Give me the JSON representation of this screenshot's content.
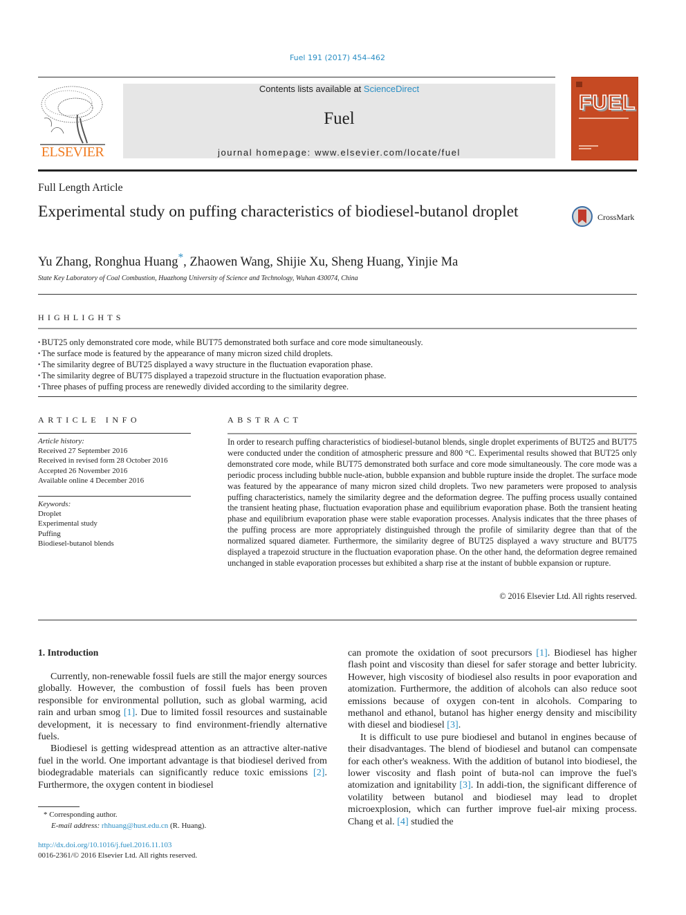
{
  "header": {
    "journal_ref": "Fuel 191 (2017) 454–462",
    "contents_prefix": "Contents lists available at ",
    "contents_link": "ScienceDirect",
    "journal_title": "Fuel",
    "homepage_prefix": "journal homepage: ",
    "homepage_url": "www.elsevier.com/locate/fuel",
    "publisher_logo": "ELSEVIER",
    "cover_title": "FUEL"
  },
  "article": {
    "type": "Full Length Article",
    "title": "Experimental study on puffing characteristics of biodiesel-butanol droplet",
    "crossmark_label": "CrossMark",
    "authors": "Yu Zhang, Ronghua Huang",
    "authors_star": "*",
    "authors_rest": ", Zhaowen Wang, Shijie Xu, Sheng Huang, Yinjie Ma",
    "affiliation": "State Key Laboratory of Coal Combustion, Huazhong University of Science and Technology, Wuhan 430074, China"
  },
  "highlights": {
    "heading": "HIGHLIGHTS",
    "items": [
      "BUT25 only demonstrated core mode, while BUT75 demonstrated both surface and core mode simultaneously.",
      "The surface mode is featured by the appearance of many micron sized child droplets.",
      "The similarity degree of BUT25 displayed a wavy structure in the fluctuation evaporation phase.",
      "The similarity degree of BUT75 displayed a trapezoid structure in the fluctuation evaporation phase.",
      "Three phases of puffing process are renewedly divided according to the similarity degree."
    ]
  },
  "article_info": {
    "heading": "ARTICLE INFO",
    "history_label": "Article history:",
    "history": [
      "Received 27 September 2016",
      "Received in revised form 28 October 2016",
      "Accepted 26 November 2016",
      "Available online 4 December 2016"
    ],
    "keywords_label": "Keywords:",
    "keywords": [
      "Droplet",
      "Experimental study",
      "Puffing",
      "Biodiesel-butanol blends"
    ]
  },
  "abstract": {
    "heading": "ABSTRACT",
    "text": "In order to research puffing characteristics of biodiesel-butanol blends, single droplet experiments of BUT25 and BUT75 were conducted under the condition of atmospheric pressure and 800 °C. Experimental results showed that BUT25 only demonstrated core mode, while BUT75 demonstrated both surface and core mode simultaneously. The core mode was a periodic process including bubble nucle-ation, bubble expansion and bubble rupture inside the droplet. The surface mode was featured by the appearance of many micron sized child droplets. Two new parameters were proposed to analysis puffing characteristics, namely the similarity degree and the deformation degree. The puffing process usually contained the transient heating phase, fluctuation evaporation phase and equilibrium evaporation phase. Both the transient heating phase and equilibrium evaporation phase were stable evaporation processes. Analysis indicates that the three phases of the puffing process are more appropriately distinguished through the profile of similarity degree than that of the normalized squared diameter. Furthermore, the similarity degree of BUT25 displayed a wavy structure and BUT75 displayed a trapezoid structure in the fluctuation evaporation phase. On the other hand, the deformation degree remained unchanged in stable evaporation processes but exhibited a sharp rise at the instant of bubble expansion or rupture.",
    "copyright": "© 2016 Elsevier Ltd. All rights reserved."
  },
  "intro": {
    "heading": "1. Introduction",
    "p1_a": "Currently, non-renewable fossil fuels are still the major energy sources globally. However, the combustion of fossil fuels has been proven responsible for environmental pollution, such as global warming, acid rain and urban smog ",
    "p1_ref": "[1]",
    "p1_b": ". Due to limited fossil resources and sustainable development, it is necessary to find environment-friendly alternative fuels.",
    "p2_a": "Biodiesel is getting widespread attention as an attractive alter-native fuel in the world. One important advantage is that biodiesel derived from biodegradable materials can significantly reduce toxic emissions ",
    "p2_ref": "[2]",
    "p2_b": ". Furthermore, the oxygen content in biodiesel",
    "r1_a": "can promote the oxidation of soot precursors ",
    "r1_ref1": "[1]",
    "r1_b": ". Biodiesel has higher flash point and viscosity than diesel for safer storage and better lubricity. However, high viscosity of biodiesel also results in poor evaporation and atomization. Furthermore, the addition of alcohols can also reduce soot emissions because of oxygen con-tent in alcohols. Comparing to methanol and ethanol, butanol has higher energy density and miscibility with diesel and biodiesel ",
    "r1_ref2": "[3]",
    "r1_c": ".",
    "r2_a": "It is difficult to use pure biodiesel and butanol in engines because of their disadvantages. The blend of biodiesel and butanol can compensate for each other's weakness. With the addition of butanol into biodiesel, the lower viscosity and flash point of buta-nol can improve the fuel's atomization and ignitability ",
    "r2_ref1": "[3]",
    "r2_b": ". In addi-tion, the significant difference of volatility between butanol and biodiesel may lead to droplet microexplosion, which can further improve fuel-air mixing process. Chang et al. ",
    "r2_ref2": "[4]",
    "r2_c": " studied the"
  },
  "footer": {
    "corresponding": "* Corresponding author.",
    "email_label": "E-mail address: ",
    "email": "rhhuang@hust.edu.cn",
    "email_suffix": " (R. Huang).",
    "doi": "http://dx.doi.org/10.1016/j.fuel.2016.11.103",
    "issn": "0016-2361/© 2016 Elsevier Ltd. All rights reserved."
  }
}
